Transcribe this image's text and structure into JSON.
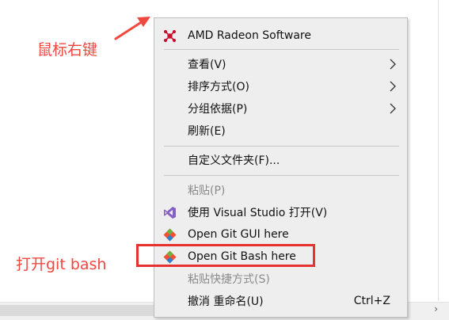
{
  "menu": {
    "items": [
      {
        "label": "AMD Radeon Software",
        "icon": "amd-radeon-icon"
      },
      {
        "label": "查看(V)",
        "submenu": true
      },
      {
        "label": "排序方式(O)",
        "submenu": true
      },
      {
        "label": "分组依据(P)",
        "submenu": true
      },
      {
        "label": "刷新(E)"
      },
      {
        "label": "自定义文件夹(F)..."
      },
      {
        "label": "粘贴(P)",
        "disabled": true
      },
      {
        "label": "使用 Visual Studio 打开(V)",
        "icon": "visual-studio-icon"
      },
      {
        "label": "Open Git GUI here",
        "icon": "git-gui-icon"
      },
      {
        "label": "Open Git Bash here",
        "icon": "git-bash-icon"
      },
      {
        "label": "粘贴快捷方式(S)",
        "disabled": true
      },
      {
        "label": "撤消 重命名(U)",
        "shortcut": "Ctrl+Z"
      }
    ]
  },
  "annotations": {
    "right_click": "鼠标右键",
    "open_git_bash": "打开git bash"
  },
  "colors": {
    "annotation": "#f0473f",
    "highlight_box": "#e5312f",
    "menu_background": "#eeeeee"
  }
}
